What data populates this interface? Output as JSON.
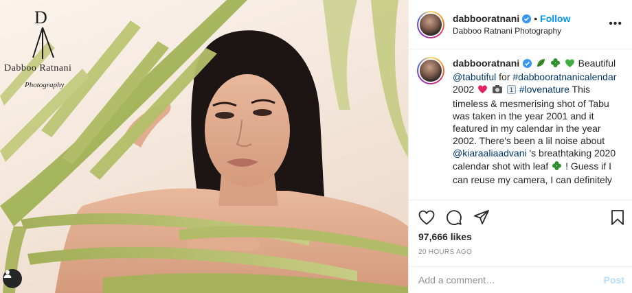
{
  "photo": {
    "watermark_name": "Dabboo Ratnani",
    "watermark_sub": "Photography"
  },
  "header": {
    "username": "dabbooratnani",
    "separator": "•",
    "follow_label": "Follow",
    "subtitle": "Dabboo Ratnani Photography",
    "more_label": "•••"
  },
  "caption": {
    "username": "dabbooratnani",
    "t1": " Beautiful ",
    "mention1": "@tabutiful",
    "t2": " for ",
    "hashtag1": "#dabbooratnanicalendar",
    "t3": " 2002 ",
    "t4": " ",
    "hashtag2": "#lovenature",
    "t5": " This timeless & mesmerising shot of Tabu was taken in the year 2001 and it featured in my calendar in the year 2002. There's been a lil noise about ",
    "mention2": "@kiaraaliaadvani",
    "t6": " 's breathtaking 2020 calendar shot with leaf ",
    "t7": " ! Guess if I can reuse my camera, I can definitely"
  },
  "stats": {
    "likes": "97,666 likes",
    "time_ago": "20 HOURS AGO"
  },
  "comment": {
    "placeholder": "Add a comment…",
    "post_label": "Post"
  },
  "icons": {
    "heart": "heart-icon",
    "comment": "comment-icon",
    "share": "share-icon",
    "save": "bookmark-icon",
    "verified": "verified-badge-icon",
    "tag": "user-tag-icon"
  },
  "colors": {
    "link": "#00376b",
    "follow": "#0095f6",
    "post_disabled": "#b2dffc",
    "muted": "#8e8e8e",
    "heart_emoji": "#e0245e",
    "leaf_green": "#3e8e2e"
  }
}
